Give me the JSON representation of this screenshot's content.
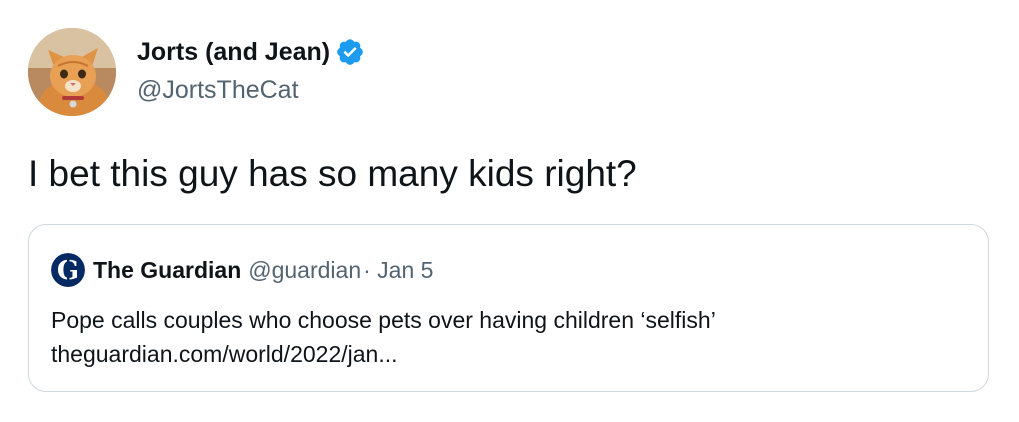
{
  "tweet": {
    "author": {
      "display_name": "Jorts (and Jean)",
      "handle": "@JortsTheCat",
      "verified": true,
      "avatar_icon": "orange-cat-avatar"
    },
    "text": "I bet this guy has so many kids right?"
  },
  "quote": {
    "author": {
      "display_name": "The Guardian",
      "handle": "@guardian",
      "avatar_icon": "guardian-logo-icon"
    },
    "date": "· Jan 5",
    "headline": "Pope calls couples who choose pets over having children ‘selfish’",
    "link": "theguardian.com/world/2022/jan..."
  },
  "colors": {
    "text_primary": "#0f1419",
    "text_secondary": "#536471",
    "verified_blue": "#1d9bf0",
    "border": "#cfd9de",
    "guardian_navy": "#052962"
  }
}
